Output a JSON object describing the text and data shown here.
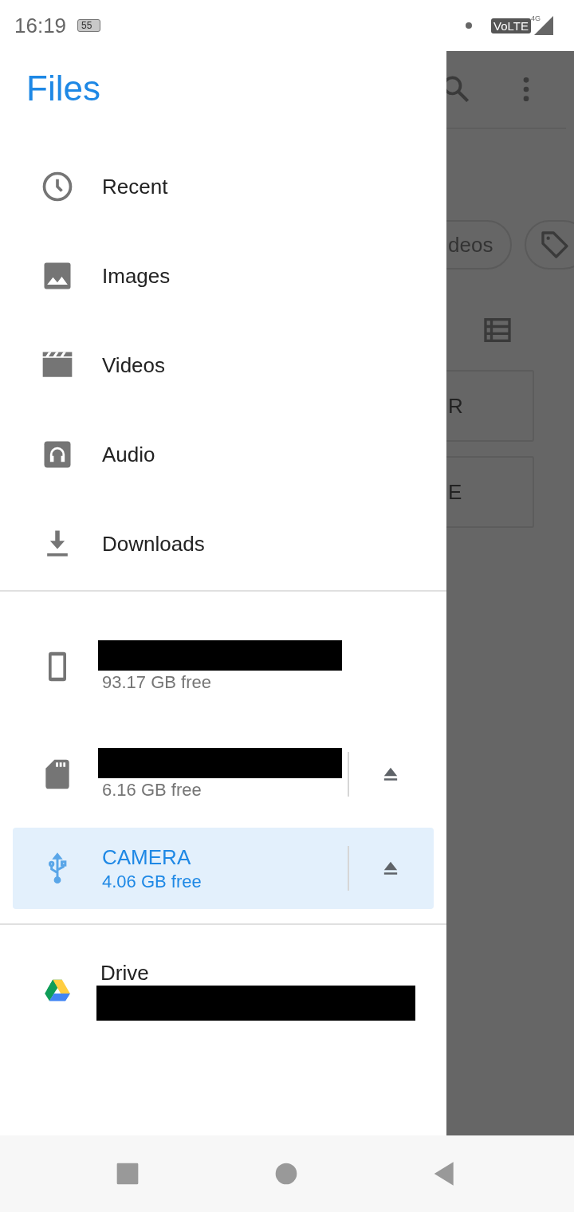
{
  "status_bar": {
    "time": "16:19",
    "battery": "55",
    "network": "4G",
    "volte": "VoLTE"
  },
  "drawer": {
    "title": "Files",
    "categories": [
      {
        "kind": "recent",
        "label": "Recent"
      },
      {
        "kind": "images",
        "label": "Images"
      },
      {
        "kind": "videos",
        "label": "Videos"
      },
      {
        "kind": "audio",
        "label": "Audio"
      },
      {
        "kind": "downloads",
        "label": "Downloads"
      }
    ],
    "storage": [
      {
        "kind": "phone",
        "name_redacted": true,
        "free": "93.17 GB free",
        "ejectable": false,
        "selected": false
      },
      {
        "kind": "sdcard",
        "name_redacted": true,
        "free": "6.16 GB free",
        "ejectable": true,
        "selected": false
      },
      {
        "kind": "usb",
        "name_redacted": false,
        "name": "CAMERA",
        "free": "4.06 GB free",
        "ejectable": true,
        "selected": true
      }
    ],
    "cloud": [
      {
        "kind": "drive",
        "label": "Drive",
        "account_redacted": true
      }
    ]
  },
  "background": {
    "chips": [
      {
        "kind": "text",
        "label": "deos"
      },
      {
        "kind": "tag"
      }
    ],
    "cards": [
      {
        "label": "R"
      },
      {
        "label": "E"
      }
    ]
  }
}
